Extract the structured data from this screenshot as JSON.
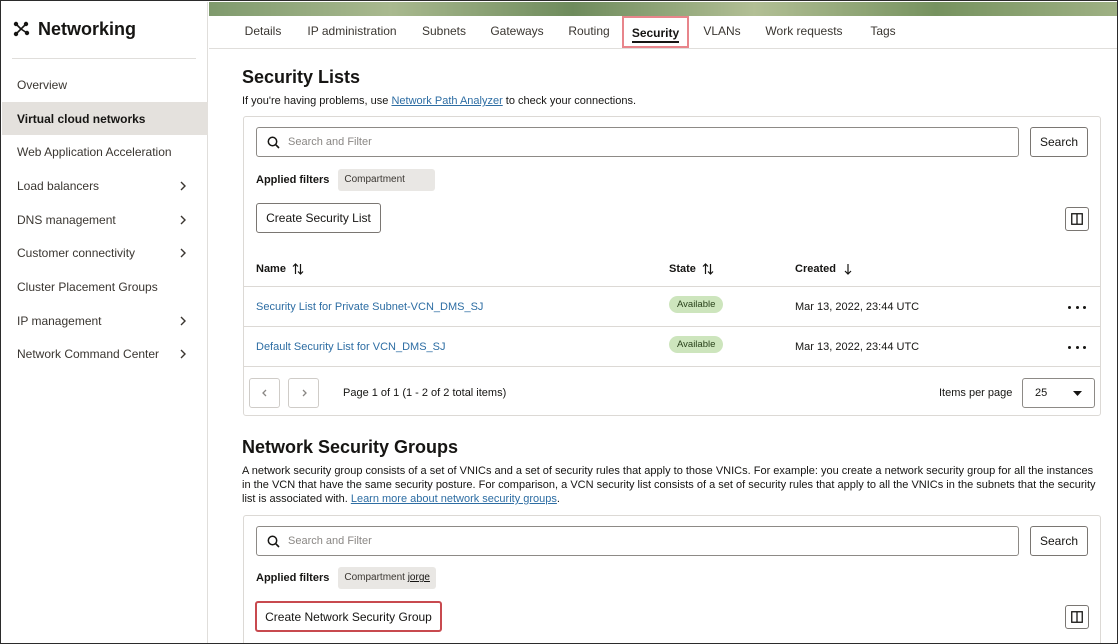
{
  "app": {
    "title": "Networking"
  },
  "sidebar": {
    "items": [
      {
        "label": "Overview",
        "has_children": false,
        "active": false
      },
      {
        "label": "Virtual cloud networks",
        "has_children": false,
        "active": true
      },
      {
        "label": "Web Application Acceleration",
        "has_children": false,
        "active": false
      },
      {
        "label": "Load balancers",
        "has_children": true,
        "active": false
      },
      {
        "label": "DNS management",
        "has_children": true,
        "active": false
      },
      {
        "label": "Customer connectivity",
        "has_children": true,
        "active": false
      },
      {
        "label": "Cluster Placement Groups",
        "has_children": false,
        "active": false
      },
      {
        "label": "IP management",
        "has_children": true,
        "active": false
      },
      {
        "label": "Network Command Center",
        "has_children": true,
        "active": false
      }
    ]
  },
  "tabs": [
    {
      "label": "Details",
      "active": false
    },
    {
      "label": "IP administration",
      "active": false
    },
    {
      "label": "Subnets",
      "active": false
    },
    {
      "label": "Gateways",
      "active": false
    },
    {
      "label": "Routing",
      "active": false
    },
    {
      "label": "Security",
      "active": true
    },
    {
      "label": "VLANs",
      "active": false
    },
    {
      "label": "Work requests",
      "active": false
    },
    {
      "label": "Tags",
      "active": false
    }
  ],
  "security_lists": {
    "title": "Security Lists",
    "help_prefix": "If you're having problems, use ",
    "help_link": "Network Path Analyzer",
    "help_suffix": " to check your connections.",
    "search_placeholder": "Search and Filter",
    "search_button": "Search",
    "applied_filters_label": "Applied filters",
    "filter_chip": "Compartment",
    "create_button": "Create Security List",
    "columns": {
      "name": "Name",
      "state": "State",
      "created": "Created"
    },
    "rows": [
      {
        "name": "Security List for Private Subnet-VCN_DMS_SJ",
        "state": "Available",
        "created": "Mar 13, 2022, 23:44 UTC"
      },
      {
        "name": "Default Security List for VCN_DMS_SJ",
        "state": "Available",
        "created": "Mar 13, 2022, 23:44 UTC"
      }
    ],
    "pagination": {
      "info": "Page 1 of 1 (1 - 2 of 2 total items)",
      "items_per_page_label": "Items per page",
      "items_per_page_value": "25"
    }
  },
  "nsg": {
    "title": "Network Security Groups",
    "description": "A network security group consists of a set of VNICs and a set of security rules that apply to those VNICs. For example: you create a network security group for all the instances in the VCN that have the same security posture. For comparison, a VCN security list consists of a set of security rules that apply to all the VNICs in the subnets that the security list is associated with. ",
    "learn_more_link": "Learn more about network security groups",
    "learn_more_suffix": ".",
    "search_placeholder": "Search and Filter",
    "search_button": "Search",
    "applied_filters_label": "Applied filters",
    "filter_chip_key": "Compartment",
    "filter_chip_value": "jorge",
    "create_button": "Create Network Security Group"
  },
  "colors": {
    "link": "#2d6da3",
    "active_nav_bg": "#e4e1dd",
    "highlight": "#e8858b",
    "available_badge": "#cde5bd",
    "create_nsg_highlight": "#c84a4f"
  }
}
